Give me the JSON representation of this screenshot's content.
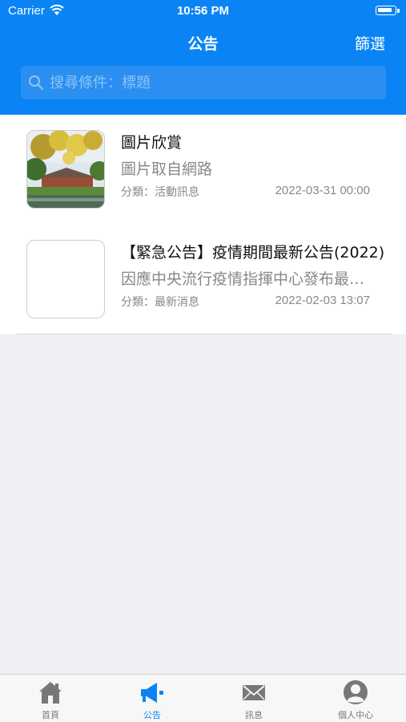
{
  "status_bar": {
    "carrier": "Carrier",
    "time": "10:56 PM"
  },
  "nav": {
    "title": "公告",
    "filter_label": "篩選"
  },
  "search": {
    "placeholder": "搜尋條件：標題",
    "value": ""
  },
  "announcements": [
    {
      "title": "圖片欣賞",
      "subtitle": "圖片取自網路",
      "category": "分類：活動訊息",
      "date": "2022-03-31 00:00",
      "has_image": true
    },
    {
      "title": "【緊急公告】疫情期間最新公告(2022)",
      "subtitle": "因應中央流行疫情指揮中心發布最新防疫措施",
      "category": "分類：最新消息",
      "date": "2022-02-03 13:07",
      "has_image": false
    }
  ],
  "tabs": [
    {
      "label": "首頁",
      "icon": "home-icon",
      "active": false
    },
    {
      "label": "公告",
      "icon": "megaphone-icon",
      "active": true
    },
    {
      "label": "訊息",
      "icon": "envelope-icon",
      "active": false
    },
    {
      "label": "個人中心",
      "icon": "user-icon",
      "active": false
    }
  ],
  "colors": {
    "brand": "#0a84f5",
    "inactive_tab": "#777777",
    "background": "#efeff4"
  }
}
